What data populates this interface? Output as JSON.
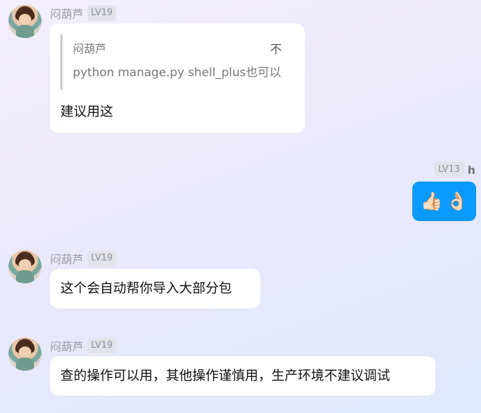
{
  "messages": [
    {
      "sender": "闷葫芦",
      "level": "LV19",
      "quote": {
        "author": "闷葫芦",
        "mark": "不",
        "text": "python manage.py shell_plus也可以"
      },
      "text": "建议用这"
    },
    {
      "sender": "h",
      "level": "LV13",
      "emoji": [
        "👍🏻",
        "👌🏻"
      ]
    },
    {
      "sender": "闷葫芦",
      "level": "LV19",
      "text": "这个会自动帮你导入大部分包"
    },
    {
      "sender": "闷葫芦",
      "level": "LV19",
      "text": "查的操作可以用，其他操作谨慎用，生产环境不建议调试"
    }
  ]
}
